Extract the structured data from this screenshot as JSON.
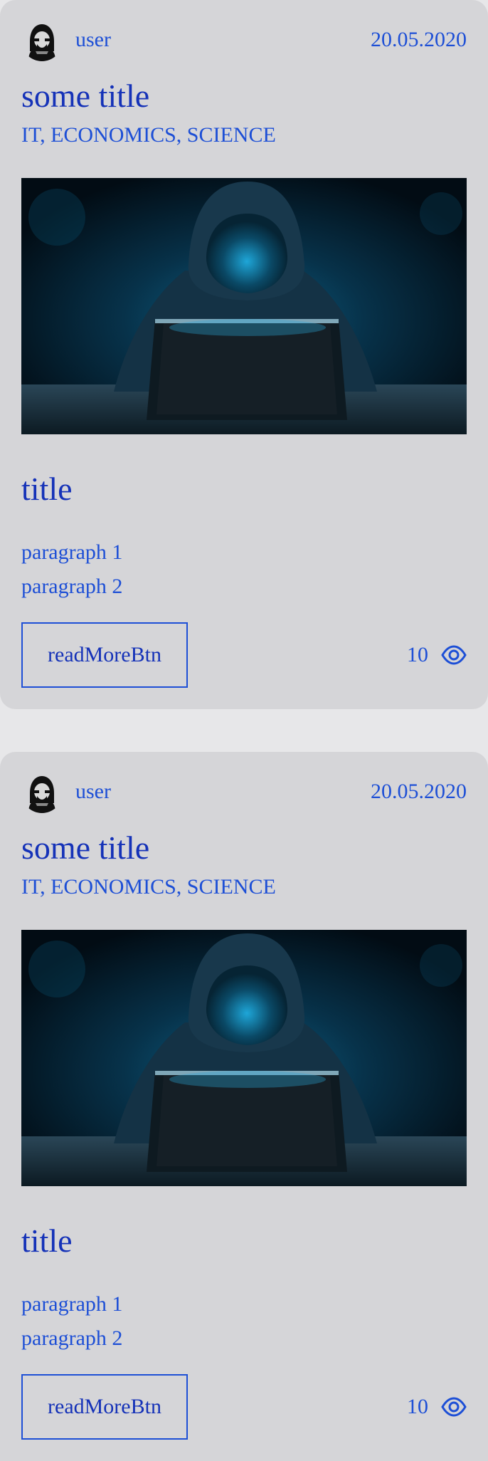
{
  "posts": [
    {
      "author": "user",
      "date": "20.05.2020",
      "title": "some title",
      "tags": "IT, ECONOMICS, SCIENCE",
      "subtitle": "title",
      "paragraphs": [
        "paragraph 1",
        "paragraph 2"
      ],
      "read_more_label": "readMoreBtn",
      "views": "10",
      "avatar_icon": "hacker-avatar-icon",
      "views_icon": "eye-icon",
      "image": "hooded-hacker-laptop-photo"
    },
    {
      "author": "user",
      "date": "20.05.2020",
      "title": "some title",
      "tags": "IT, ECONOMICS, SCIENCE",
      "subtitle": "title",
      "paragraphs": [
        "paragraph 1",
        "paragraph 2"
      ],
      "read_more_label": "readMoreBtn",
      "views": "10",
      "avatar_icon": "hacker-avatar-icon",
      "views_icon": "eye-icon",
      "image": "hooded-hacker-laptop-photo"
    }
  ],
  "colors": {
    "page_background": "#e7e7e9",
    "card_background": "#d5d5d8",
    "link_blue": "#1d4fd6",
    "heading_blue": "#1532b8"
  }
}
